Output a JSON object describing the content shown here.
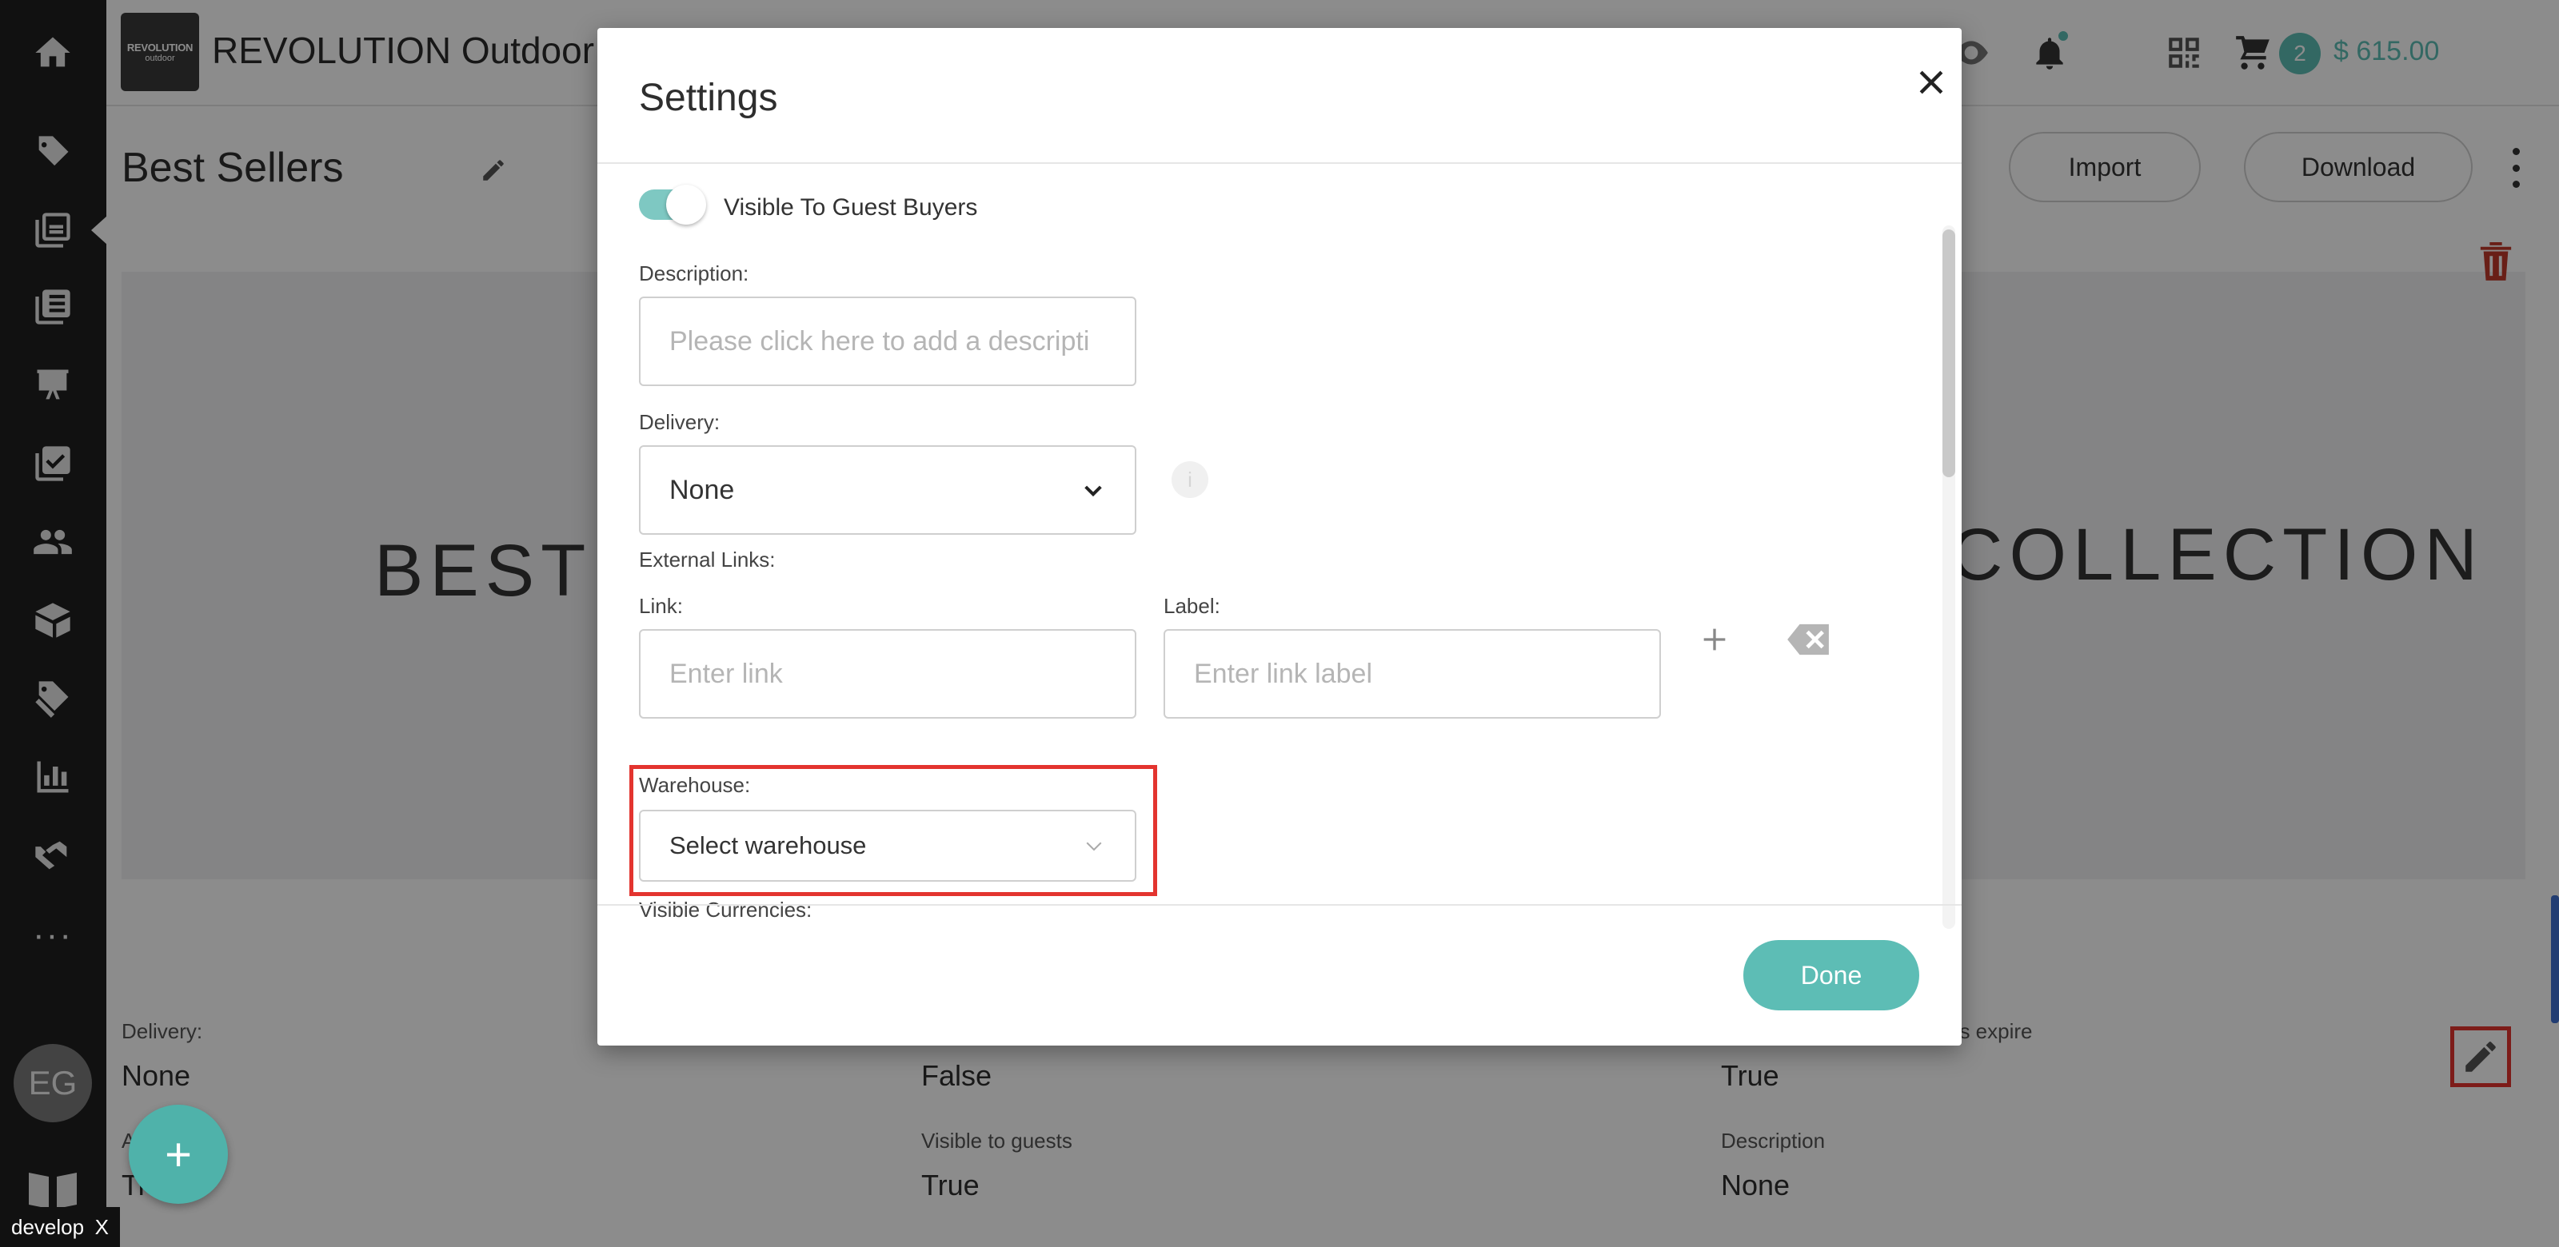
{
  "app": {
    "brand_name": "REVOLUTION Outdoor",
    "logo_line1": "REVOLUTION",
    "logo_line2": "outdoor",
    "cart_count": "2",
    "cart_total": "$ 615.00"
  },
  "user": {
    "initials": "EG"
  },
  "page": {
    "title": "Best Sellers",
    "import_label": "Import",
    "download_label": "Download",
    "banner_left": "BEST S",
    "banner_right": "COLLECTION"
  },
  "details": [
    {
      "label": "Delivery:",
      "value": "None"
    },
    {
      "label": "",
      "value": "False"
    },
    {
      "label": "es expire",
      "value": "True"
    },
    {
      "label": "A",
      "value": "Tr"
    },
    {
      "label": "Visible to guests",
      "value": "True"
    },
    {
      "label": "Description",
      "value": "None"
    }
  ],
  "modal": {
    "title": "Settings",
    "guest_toggle_label": "Visible To Guest Buyers",
    "guest_toggle_on": true,
    "description_label": "Description:",
    "description_placeholder": "Please click here to add a descripti",
    "delivery_label": "Delivery:",
    "delivery_value": "None",
    "info_glyph": "i",
    "external_links_label": "External Links:",
    "link_label": "Link:",
    "link_placeholder": "Enter link",
    "link_label_label": "Label:",
    "link_label_placeholder": "Enter link label",
    "warehouse_label": "Warehouse:",
    "warehouse_placeholder": "Select warehouse",
    "visible_currencies_label": "Visible Currencies:",
    "done_label": "Done"
  },
  "dev_badge": {
    "label": "develop",
    "close": "X"
  },
  "fab_label": "+",
  "colors": {
    "accent": "#5dbdb5",
    "highlight": "#e3342f",
    "sidebar": "#1f1f1f"
  }
}
